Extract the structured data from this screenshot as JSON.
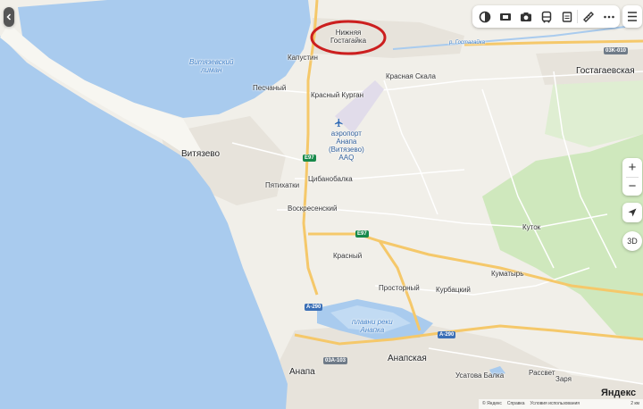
{
  "map": {
    "colors": {
      "sea": "#a9cbee",
      "land": "#f1efe9",
      "spit": "#f7f6f1",
      "urban": "#e7e3db",
      "green": "#cfe8bd",
      "road": "#ffffff",
      "highway": "#f5c86a",
      "highlight_circle": "#cc1f1f"
    },
    "places": [
      {
        "id": "nizhnyaya",
        "text": "Нижняя\nГостагайка"
      },
      {
        "id": "gostagaevskaya",
        "text": "Гостагаевская"
      },
      {
        "id": "kapustin",
        "text": "Капустин"
      },
      {
        "id": "krasnaya-skala",
        "text": "Красная Скала"
      },
      {
        "id": "pesochny",
        "text": "Песчаный"
      },
      {
        "id": "krasny-kurgan",
        "text": "Красный Курган"
      },
      {
        "id": "vityazevo",
        "text": "Витязево"
      },
      {
        "id": "pyatikhatki",
        "text": "Пятихатки"
      },
      {
        "id": "tsibanobalka",
        "text": "Цибанобалка"
      },
      {
        "id": "voskresensky",
        "text": "Воскресенский"
      },
      {
        "id": "krasny",
        "text": "Красный"
      },
      {
        "id": "kutok",
        "text": "Куток"
      },
      {
        "id": "kumatyr",
        "text": "Куматырь"
      },
      {
        "id": "prostorny",
        "text": "Просторный"
      },
      {
        "id": "kurbatsky",
        "text": "Курбацкий"
      },
      {
        "id": "anapa",
        "text": "Анапа"
      },
      {
        "id": "anapskaya",
        "text": "Анапская"
      },
      {
        "id": "ustatova",
        "text": "Усатова Балка"
      },
      {
        "id": "rassvet",
        "text": "Рассвет"
      },
      {
        "id": "zarya",
        "text": "Заря"
      }
    ],
    "water_labels": [
      {
        "id": "vityazevsky-liman",
        "text": "Витязевский\nлиман"
      },
      {
        "id": "plavni",
        "text": "плавни реки\nАнапка"
      },
      {
        "id": "gostagaika-river",
        "text": "р. Гостагайка"
      }
    ],
    "airport": {
      "text": "аэропорт\nАнапа\n(Витязево)\nAAQ",
      "icon": "airplane-icon"
    },
    "road_shields": [
      {
        "id": "e97-north",
        "text": "E97",
        "kind": "e"
      },
      {
        "id": "e97-mid",
        "text": "E97",
        "kind": "e"
      },
      {
        "id": "a290-west",
        "text": "A-290",
        "kind": "a"
      },
      {
        "id": "a290-east",
        "text": "A-290",
        "kind": "a"
      },
      {
        "id": "r03k-103",
        "text": "03A-103",
        "kind": "r"
      },
      {
        "id": "r03k-010",
        "text": "03K-010",
        "kind": "r"
      }
    ],
    "watermark": "Яндекс",
    "footer": {
      "copyright": "© Яндекс",
      "help": "Справка",
      "terms": "Условия использования",
      "scale": "2 км"
    }
  },
  "controls": {
    "back_icon": "chevron-left-icon",
    "toolbar": [
      "layers-icon",
      "panorama-icon",
      "camera-icon",
      "transit-icon",
      "bookmark-icon",
      "ruler-icon",
      "more-icon"
    ],
    "menu_icon": "menu-icon",
    "zoom_in": "+",
    "zoom_out": "−",
    "locate_icon": "locate-arrow-icon",
    "three_d": "3D"
  }
}
